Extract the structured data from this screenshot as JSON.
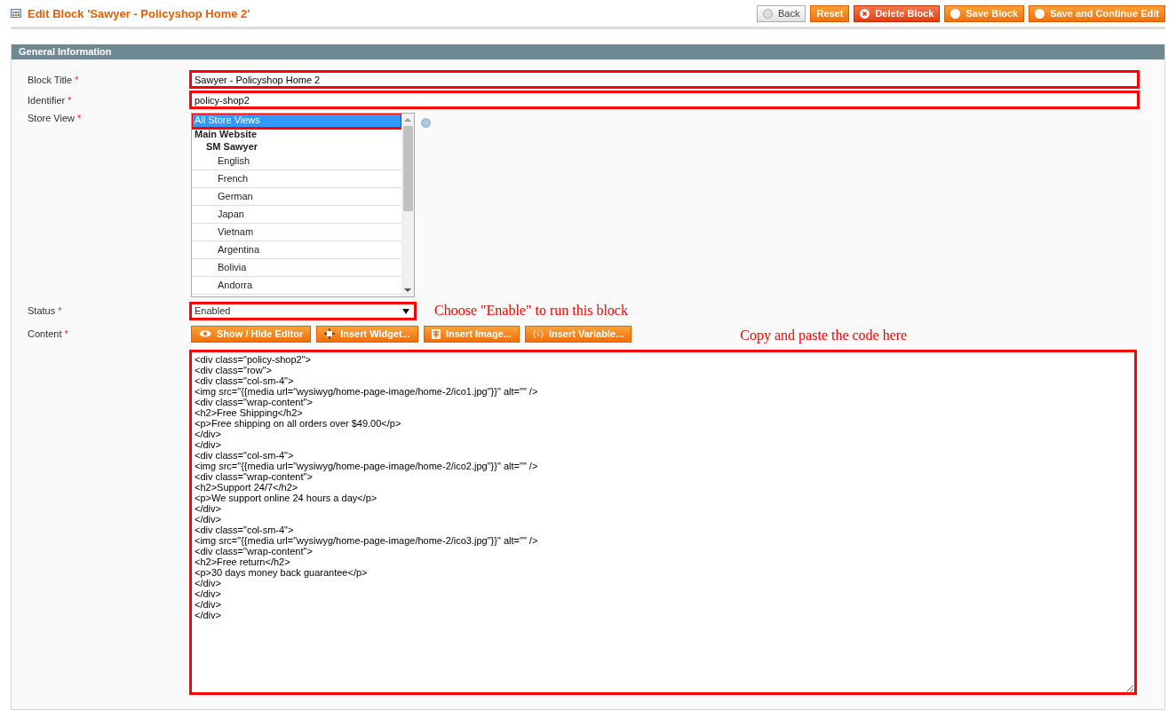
{
  "page_title": "Edit Block 'Sawyer - Policyshop Home 2'",
  "buttons": [
    {
      "label": "Back",
      "kind": "back"
    },
    {
      "label": "Reset",
      "kind": "plain"
    },
    {
      "label": "Delete Block",
      "kind": "delete"
    },
    {
      "label": "Save Block",
      "kind": "save"
    },
    {
      "label": "Save and Continue Edit",
      "kind": "save"
    }
  ],
  "section": {
    "title": "General Information"
  },
  "fields": {
    "block_title": {
      "label": "Block Title",
      "required": "*",
      "value": "Sawyer - Policyshop Home 2",
      "highlighted": true
    },
    "identifier": {
      "label": "Identifier",
      "required": "*",
      "value": "policy-shop2",
      "highlighted": true
    },
    "store_view": {
      "label": "Store View",
      "required": "*",
      "highlighted": true,
      "options": [
        {
          "label": "All Store Views",
          "kind": "option",
          "selected": true
        },
        {
          "label": "Main Website",
          "kind": "group",
          "selected": false,
          "children": [
            {
              "label": "SM Sawyer",
              "kind": "group",
              "selected": false,
              "children": [
                {
                  "label": "English",
                  "kind": "option",
                  "selected": false
                },
                {
                  "label": "French",
                  "kind": "option",
                  "selected": false
                },
                {
                  "label": "German",
                  "kind": "option",
                  "selected": false
                },
                {
                  "label": "Japan",
                  "kind": "option",
                  "selected": false
                },
                {
                  "label": "Vietnam",
                  "kind": "option",
                  "selected": false
                },
                {
                  "label": "Argentina",
                  "kind": "option",
                  "selected": false
                },
                {
                  "label": "Bolivia",
                  "kind": "option",
                  "selected": false
                },
                {
                  "label": "Andorra",
                  "kind": "option",
                  "selected": false
                }
              ]
            }
          ]
        }
      ]
    },
    "status": {
      "label": "Status",
      "required": "*",
      "value": "Enabled",
      "highlighted": true,
      "note": "Choose \"Enable\" to run this block"
    },
    "content": {
      "label": "Content",
      "required": "*",
      "highlighted": true,
      "note": "Copy and paste the code here",
      "editor_buttons": [
        {
          "label": "Show / Hide Editor",
          "kind": "eye"
        },
        {
          "label": "Insert Widget...",
          "kind": "widget"
        },
        {
          "label": "Insert Image...",
          "kind": "image"
        },
        {
          "label": "Insert Variable...",
          "kind": "variable"
        }
      ],
      "lines": [
        "<div class=\"policy-shop2\">",
        "<div class=\"row\">",
        "<div class=\"col-sm-4\">",
        "<img src=\"{{media url=\"wysiwyg/home-page-image/home-2/ico1.jpg\"}}\" alt=\"\" />",
        "<div class=\"wrap-content\">",
        "<h2>Free Shipping</h2>",
        "<p>Free shipping on all orders over $49.00</p>",
        "</div>",
        "</div>",
        "<div class=\"col-sm-4\">",
        "<img src=\"{{media url=\"wysiwyg/home-page-image/home-2/ico2.jpg\"}}\" alt=\"\" />",
        "<div class=\"wrap-content\">",
        "<h2>Support 24/7</h2>",
        "<p>We support online 24 hours a day</p>",
        "</div>",
        "</div>",
        "<div class=\"col-sm-4\">",
        "<img src=\"{{media url=\"wysiwyg/home-page-image/home-2/ico3.jpg\"}}\" alt=\"\" />",
        "<div class=\"wrap-content\">",
        "<h2>Free return</h2>",
        "<p>30 days money back guarantee</p>",
        "</div>",
        "</div>",
        "</div>",
        "</div>"
      ]
    }
  }
}
